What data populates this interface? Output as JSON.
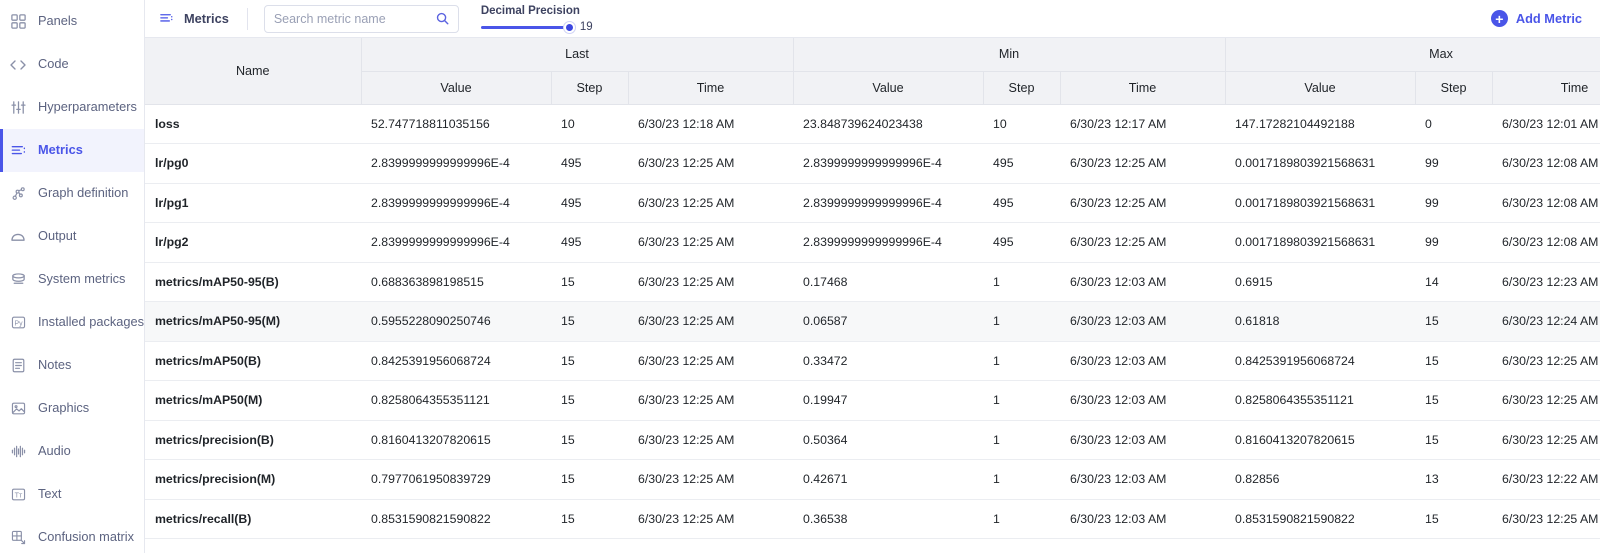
{
  "sidebar": {
    "items": [
      {
        "label": "Panels",
        "icon": "panels-icon",
        "active": false
      },
      {
        "label": "Code",
        "icon": "code-icon",
        "active": false
      },
      {
        "label": "Hyperparameters",
        "icon": "sliders-icon",
        "active": false
      },
      {
        "label": "Metrics",
        "icon": "metrics-icon",
        "active": true
      },
      {
        "label": "Graph definition",
        "icon": "graph-definition-icon",
        "active": false
      },
      {
        "label": "Output",
        "icon": "output-icon",
        "active": false
      },
      {
        "label": "System metrics",
        "icon": "system-metrics-icon",
        "active": false
      },
      {
        "label": "Installed packages",
        "icon": "python-package-icon",
        "active": false
      },
      {
        "label": "Notes",
        "icon": "notes-icon",
        "active": false
      },
      {
        "label": "Graphics",
        "icon": "image-icon",
        "active": false
      },
      {
        "label": "Audio",
        "icon": "audio-waveform-icon",
        "active": false
      },
      {
        "label": "Text",
        "icon": "text-icon",
        "active": false
      },
      {
        "label": "Confusion matrix",
        "icon": "confusion-matrix-icon",
        "active": false
      }
    ]
  },
  "toolbar": {
    "title": "Metrics",
    "title_icon": "metrics-icon",
    "search": {
      "placeholder": "Search metric name",
      "value": "",
      "icon": "search-icon"
    },
    "precision": {
      "label": "Decimal Precision",
      "value": "19",
      "min": 0,
      "max": 19,
      "fill_percent": 100
    },
    "add_metric": {
      "label": "Add Metric",
      "icon": "plus-circle-icon"
    },
    "accent_color": "#4a55e8"
  },
  "table": {
    "group_headers": [
      {
        "label": "Name",
        "span": 1,
        "rowspan": 2
      },
      {
        "label": "Last",
        "span": 3
      },
      {
        "label": "Min",
        "span": 3
      },
      {
        "label": "Max",
        "span": 3
      }
    ],
    "sub_headers": [
      "Value",
      "Step",
      "Time",
      "Value",
      "Step",
      "Time",
      "Value",
      "Step",
      "Time"
    ],
    "rows": [
      {
        "name": "loss",
        "last": {
          "value": "52.747718811035156",
          "step": "10",
          "time": "6/30/23 12:18 AM"
        },
        "min": {
          "value": "23.848739624023438",
          "step": "10",
          "time": "6/30/23 12:17 AM"
        },
        "max": {
          "value": "147.17282104492188",
          "step": "0",
          "time": "6/30/23 12:01 AM"
        }
      },
      {
        "name": "lr/pg0",
        "last": {
          "value": "2.8399999999999996E-4",
          "step": "495",
          "time": "6/30/23 12:25 AM"
        },
        "min": {
          "value": "2.8399999999999996E-4",
          "step": "495",
          "time": "6/30/23 12:25 AM"
        },
        "max": {
          "value": "0.0017189803921568631",
          "step": "99",
          "time": "6/30/23 12:08 AM"
        }
      },
      {
        "name": "lr/pg1",
        "last": {
          "value": "2.8399999999999996E-4",
          "step": "495",
          "time": "6/30/23 12:25 AM"
        },
        "min": {
          "value": "2.8399999999999996E-4",
          "step": "495",
          "time": "6/30/23 12:25 AM"
        },
        "max": {
          "value": "0.0017189803921568631",
          "step": "99",
          "time": "6/30/23 12:08 AM"
        }
      },
      {
        "name": "lr/pg2",
        "last": {
          "value": "2.8399999999999996E-4",
          "step": "495",
          "time": "6/30/23 12:25 AM"
        },
        "min": {
          "value": "2.8399999999999996E-4",
          "step": "495",
          "time": "6/30/23 12:25 AM"
        },
        "max": {
          "value": "0.0017189803921568631",
          "step": "99",
          "time": "6/30/23 12:08 AM"
        }
      },
      {
        "name": "metrics/mAP50-95(B)",
        "last": {
          "value": "0.688363898198515",
          "step": "15",
          "time": "6/30/23 12:25 AM"
        },
        "min": {
          "value": "0.17468",
          "step": "1",
          "time": "6/30/23 12:03 AM"
        },
        "max": {
          "value": "0.6915",
          "step": "14",
          "time": "6/30/23 12:23 AM"
        }
      },
      {
        "name": "metrics/mAP50-95(M)",
        "last": {
          "value": "0.5955228090250746",
          "step": "15",
          "time": "6/30/23 12:25 AM"
        },
        "min": {
          "value": "0.06587",
          "step": "1",
          "time": "6/30/23 12:03 AM"
        },
        "max": {
          "value": "0.61818",
          "step": "15",
          "time": "6/30/23 12:24 AM"
        }
      },
      {
        "name": "metrics/mAP50(B)",
        "last": {
          "value": "0.8425391956068724",
          "step": "15",
          "time": "6/30/23 12:25 AM"
        },
        "min": {
          "value": "0.33472",
          "step": "1",
          "time": "6/30/23 12:03 AM"
        },
        "max": {
          "value": "0.8425391956068724",
          "step": "15",
          "time": "6/30/23 12:25 AM"
        }
      },
      {
        "name": "metrics/mAP50(M)",
        "last": {
          "value": "0.8258064355351121",
          "step": "15",
          "time": "6/30/23 12:25 AM"
        },
        "min": {
          "value": "0.19947",
          "step": "1",
          "time": "6/30/23 12:03 AM"
        },
        "max": {
          "value": "0.8258064355351121",
          "step": "15",
          "time": "6/30/23 12:25 AM"
        }
      },
      {
        "name": "metrics/precision(B)",
        "last": {
          "value": "0.8160413207820615",
          "step": "15",
          "time": "6/30/23 12:25 AM"
        },
        "min": {
          "value": "0.50364",
          "step": "1",
          "time": "6/30/23 12:03 AM"
        },
        "max": {
          "value": "0.8160413207820615",
          "step": "15",
          "time": "6/30/23 12:25 AM"
        }
      },
      {
        "name": "metrics/precision(M)",
        "last": {
          "value": "0.7977061950839729",
          "step": "15",
          "time": "6/30/23 12:25 AM"
        },
        "min": {
          "value": "0.42671",
          "step": "1",
          "time": "6/30/23 12:03 AM"
        },
        "max": {
          "value": "0.82856",
          "step": "13",
          "time": "6/30/23 12:22 AM"
        }
      },
      {
        "name": "metrics/recall(B)",
        "last": {
          "value": "0.8531590821590822",
          "step": "15",
          "time": "6/30/23 12:25 AM"
        },
        "min": {
          "value": "0.36538",
          "step": "1",
          "time": "6/30/23 12:03 AM"
        },
        "max": {
          "value": "0.8531590821590822",
          "step": "15",
          "time": "6/30/23 12:25 AM"
        }
      }
    ]
  }
}
